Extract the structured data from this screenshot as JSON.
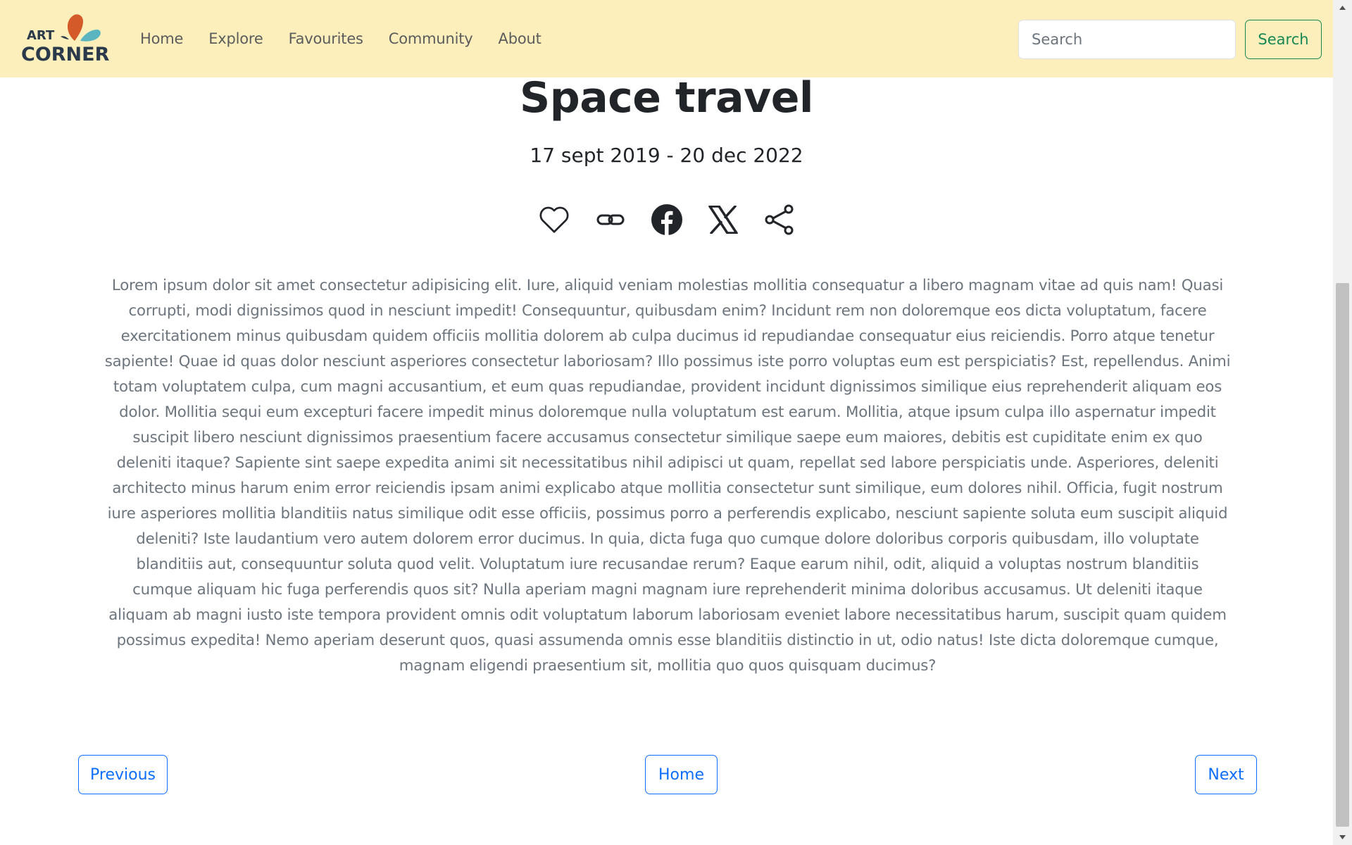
{
  "nav": {
    "brand_line1": "ART",
    "brand_line2": "CORNER",
    "links": [
      "Home",
      "Explore",
      "Favourites",
      "Community",
      "About"
    ],
    "search_placeholder": "Search",
    "search_button": "Search"
  },
  "article": {
    "title": "Space travel",
    "date_range": "17 sept 2019 - 20 dec 2022",
    "icons": [
      "heart-icon",
      "link-icon",
      "facebook-icon",
      "x-twitter-icon",
      "share-icon"
    ],
    "body": "Lorem ipsum dolor sit amet consectetur adipisicing elit. Iure, aliquid veniam molestias mollitia consequatur a libero magnam vitae ad quis nam! Quasi corrupti, modi dignissimos quod in nesciunt impedit! Consequuntur, quibusdam enim? Incidunt rem non doloremque eos dicta voluptatum, facere exercitationem minus quibusdam quidem officiis mollitia dolorem ab culpa ducimus id repudiandae consequatur eius reiciendis. Porro atque tenetur sapiente! Quae id quas dolor nesciunt asperiores consectetur laboriosam? Illo possimus iste porro voluptas eum est perspiciatis? Est, repellendus. Animi totam voluptatem culpa, cum magni accusantium, et eum quas repudiandae, provident incidunt dignissimos similique eius reprehenderit aliquam eos dolor. Mollitia sequi eum excepturi facere impedit minus doloremque nulla voluptatum est earum. Mollitia, atque ipsum culpa illo aspernatur impedit suscipit libero nesciunt dignissimos praesentium facere accusamus consectetur similique saepe eum maiores, debitis est cupiditate enim ex quo deleniti itaque? Sapiente sint saepe expedita animi sit necessitatibus nihil adipisci ut quam, repellat sed labore perspiciatis unde. Asperiores, deleniti architecto minus harum enim error reiciendis ipsam animi explicabo atque mollitia consectetur sunt similique, eum dolores nihil. Officia, fugit nostrum iure asperiores mollitia blanditiis natus similique odit esse officiis, possimus porro a perferendis explicabo, nesciunt sapiente soluta eum suscipit aliquid deleniti? Iste laudantium vero autem dolorem error ducimus. In quia, dicta fuga quo cumque dolore doloribus corporis quibusdam, illo voluptate blanditiis aut, consequuntur soluta quod velit. Voluptatum iure recusandae rerum? Eaque earum nihil, odit, aliquid a voluptas nostrum blanditiis cumque aliquam hic fuga perferendis quos sit? Nulla aperiam magni magnam iure reprehenderit minima doloribus accusamus. Ut deleniti itaque aliquam ab magni iusto iste tempora provident omnis odit voluptatum laborum laboriosam eveniet labore necessitatibus harum, suscipit quam quidem possimus expedita! Nemo aperiam deserunt quos, quasi assumenda omnis esse blanditiis distinctio in ut, odio natus! Iste dicta doloremque cumque, magnam eligendi praesentium sit, mollitia quo quos quisquam ducimus?"
  },
  "pager": {
    "previous": "Previous",
    "home": "Home",
    "next": "Next"
  },
  "colors": {
    "navbar_bg": "#fcefbc",
    "search_accent": "#198754",
    "pager_accent": "#0d6efd",
    "logo_orange": "#d45a2a",
    "logo_teal": "#5bb5c0"
  }
}
